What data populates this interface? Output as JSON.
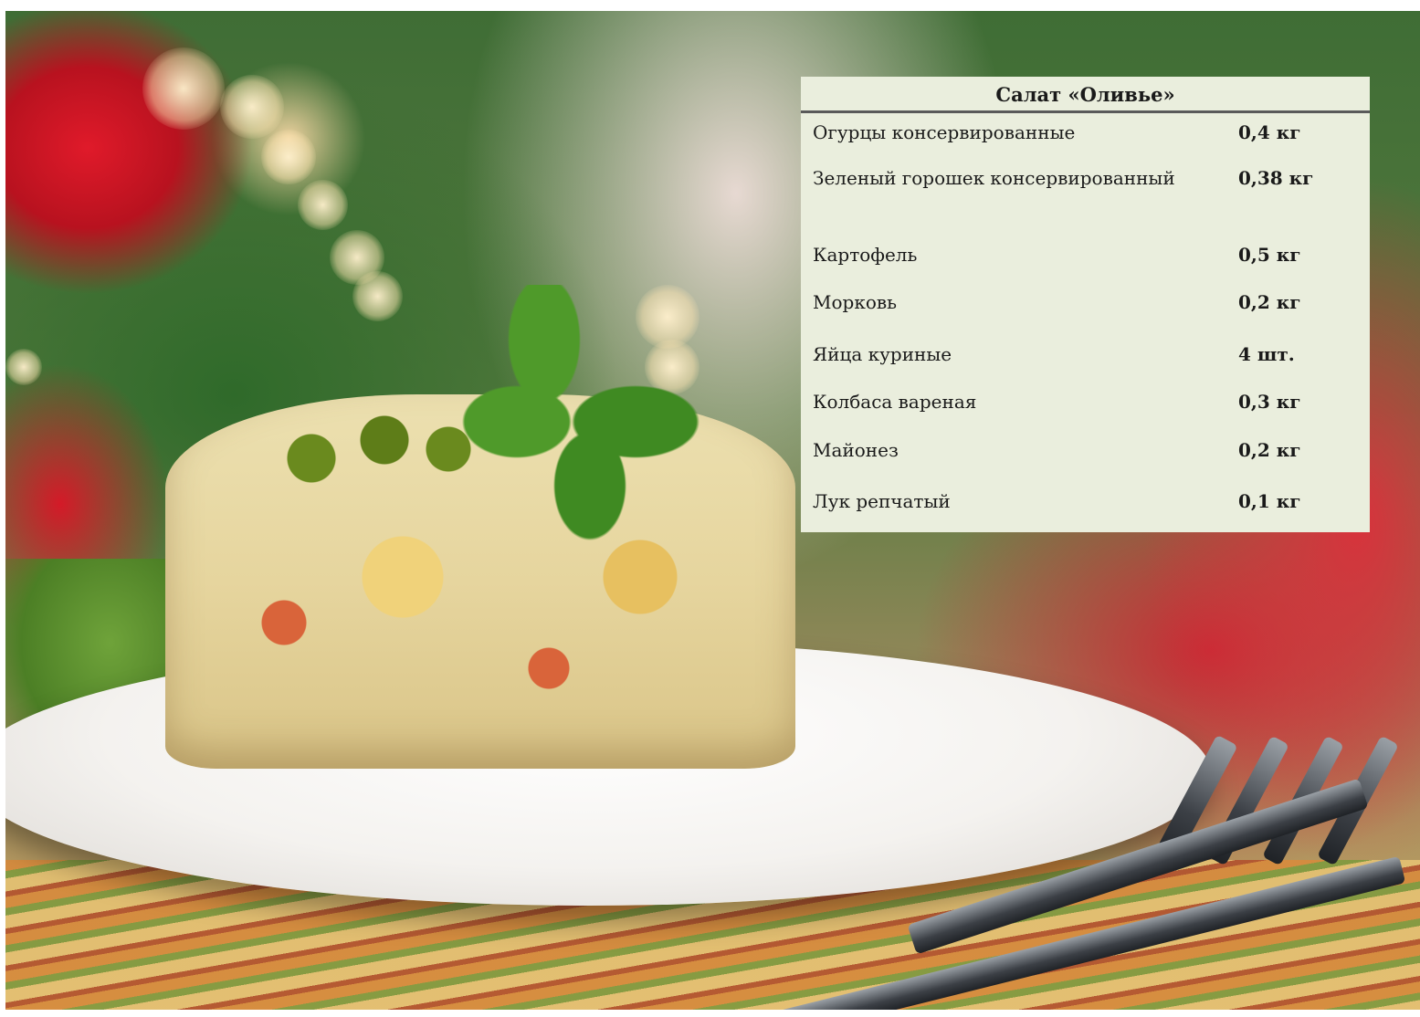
{
  "recipe": {
    "title": "Салат «Оливье»",
    "ingredients": [
      {
        "name": "Огурцы консервированные",
        "qty": "0,4 кг"
      },
      {
        "name": "Зеленый горошек  консервированный",
        "qty": "0,38 кг"
      },
      {
        "name": "Картофель",
        "qty": "0,5 кг"
      },
      {
        "name": "Морковь",
        "qty": "0,2 кг"
      },
      {
        "name": "Яйца куриные",
        "qty": "4 шт."
      },
      {
        "name": "Колбаса вареная",
        "qty": "0,3 кг"
      },
      {
        "name": "Майонез",
        "qty": "0,2 кг"
      },
      {
        "name": "Лук репчатый",
        "qty": "0,1 кг"
      }
    ]
  },
  "photo": {
    "subject": "salad-plate-photo",
    "colors": {
      "panel": "#eaeedd",
      "text": "#1a1a1a",
      "rule": "#5a5a5a"
    }
  }
}
